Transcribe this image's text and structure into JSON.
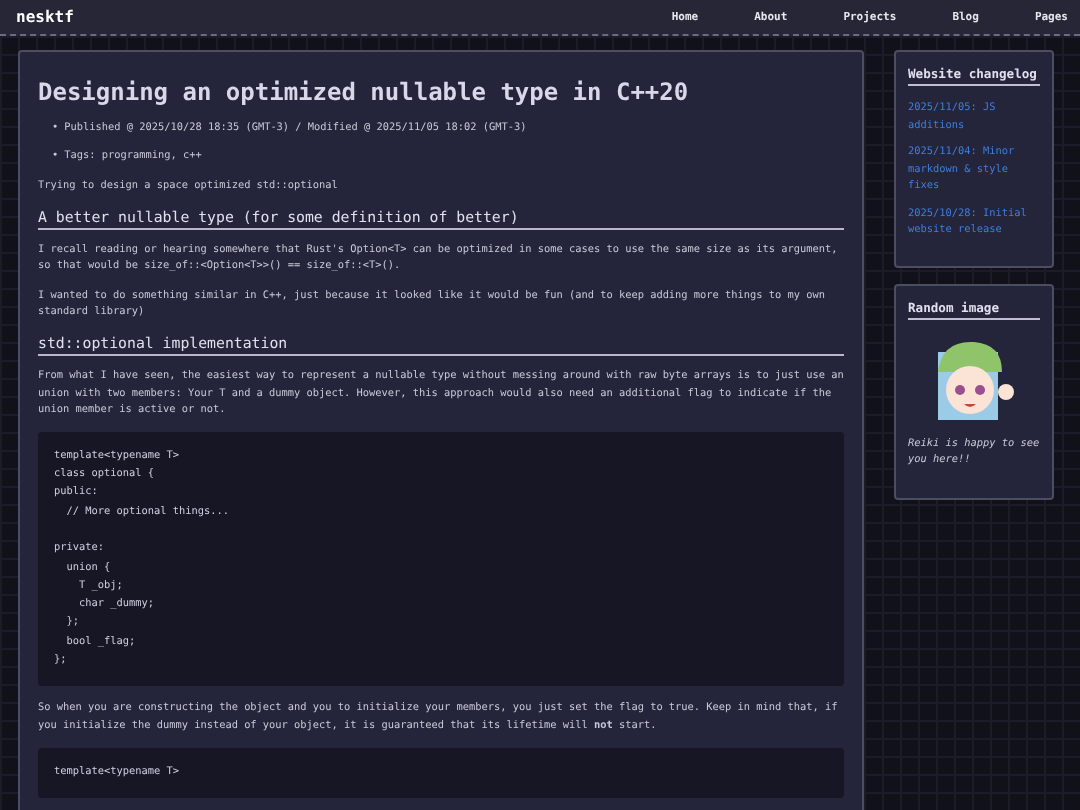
{
  "header": {
    "site_title": "nesktf",
    "nav": [
      "Home",
      "About",
      "Projects",
      "Blog",
      "Pages"
    ]
  },
  "article": {
    "title": "Designing an optimized nullable type in C++20",
    "meta": [
      {
        "bullet": "•",
        "text": "Published @ 2025/10/28 18:35 (GMT-3) / Modified @ 2025/11/05 18:02 (GMT-3)"
      },
      {
        "bullet": "•",
        "text": "Tags: programming, c++"
      }
    ],
    "blocks": [
      {
        "kind": "paragraph",
        "text": "Trying to design a space optimized std::optional"
      },
      {
        "kind": "heading",
        "text": "A better nullable type (for some definition of better)"
      },
      {
        "kind": "paragraph",
        "text": "I recall reading or hearing somewhere that Rust's Option<T> can be optimized in some cases to use the same size as its argument, so that would be size_of::<Option<T>>() == size_of::<T>()."
      },
      {
        "kind": "paragraph",
        "text": "I wanted to do something similar in C++, just because it looked like it would be fun (and to keep adding more things to my own standard library)"
      },
      {
        "kind": "heading",
        "text": "std::optional implementation"
      },
      {
        "kind": "paragraph",
        "text": "From what I have seen, the easiest way to represent a nullable type without messing around with raw byte arrays is to just use an union with two members: Your T and a dummy object. However, this approach would also need an additional flag to indicate if the union member is active or not."
      },
      {
        "kind": "code",
        "text": "template<typename T>\nclass optional {\npublic:\n  // More optional things...\n\nprivate:\n  union {\n    T _obj;\n    char _dummy;\n  };\n  bool _flag;\n};"
      },
      {
        "kind": "paragraph",
        "text": "So when you are constructing the object and you to initialize your members, you just set the flag to true. Keep in mind that, if you initialize the dummy instead of your object, it is guaranteed that its lifetime will **not** start."
      },
      {
        "kind": "code",
        "text": "template<typename T>"
      }
    ]
  },
  "sidebar": [
    {
      "kind": "links",
      "title": "Website changelog",
      "items": [
        "2025/11/05: JS additions",
        "2025/11/04: Minor markdown & style fixes",
        "2025/10/28: Initial website release"
      ]
    },
    {
      "kind": "image",
      "title": "Random image",
      "caption": "Reiki is happy to see you here!!"
    }
  ]
}
